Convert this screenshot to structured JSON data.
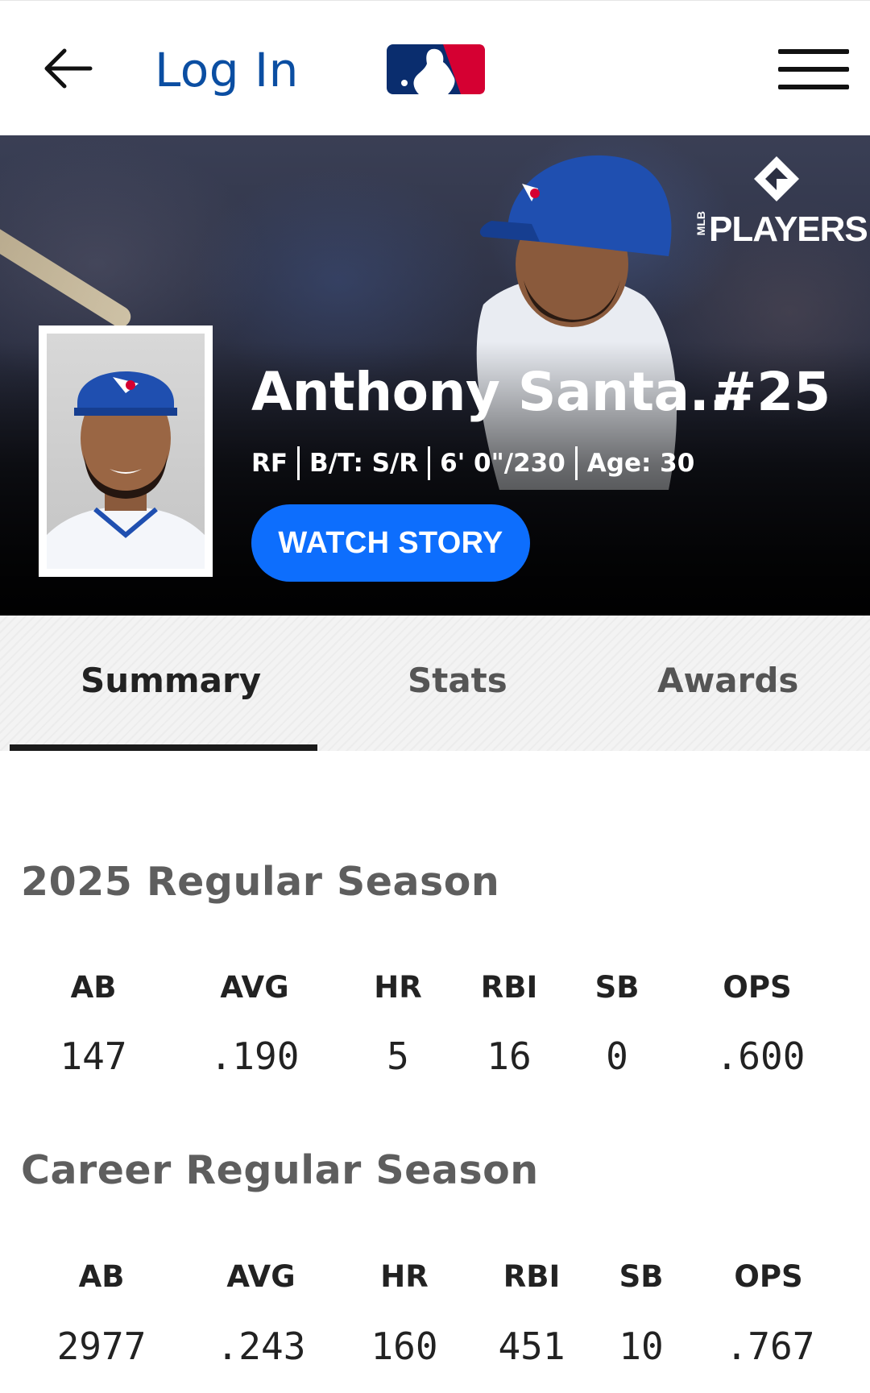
{
  "nav": {
    "login_label": "Log In",
    "icons": [
      "back-arrow-icon",
      "mlb-logo",
      "hamburger-menu-icon"
    ]
  },
  "hero": {
    "brand_text": "PLAYERS",
    "brand_small": "MLB",
    "player_name": "Anthony Santa...",
    "player_number": "#25",
    "meta": {
      "position": "RF",
      "bats_throws": "B/T: S/R",
      "height_weight": "6' 0\"/230",
      "age": "Age: 30"
    },
    "watch_story_label": "WATCH STORY"
  },
  "tabs": {
    "items": [
      {
        "label": "Summary",
        "active": true
      },
      {
        "label": "Stats",
        "active": false
      },
      {
        "label": "Awards",
        "active": false
      }
    ]
  },
  "season": {
    "title": "2025 Regular Season",
    "labels": [
      "AB",
      "AVG",
      "HR",
      "RBI",
      "SB",
      "OPS"
    ],
    "values": [
      "147",
      ".190",
      "5",
      "16",
      "0",
      ".600"
    ]
  },
  "career": {
    "title": "Career Regular Season",
    "labels": [
      "AB",
      "AVG",
      "HR",
      "RBI",
      "SB",
      "OPS"
    ],
    "values": [
      "2977",
      ".243",
      "160",
      "451",
      "10",
      ".767"
    ]
  },
  "colors": {
    "login_blue": "#0b4ea2",
    "watch_button_blue": "#0d6efd",
    "mlb_blue": "#0a2d6e",
    "mlb_red": "#d50032"
  }
}
